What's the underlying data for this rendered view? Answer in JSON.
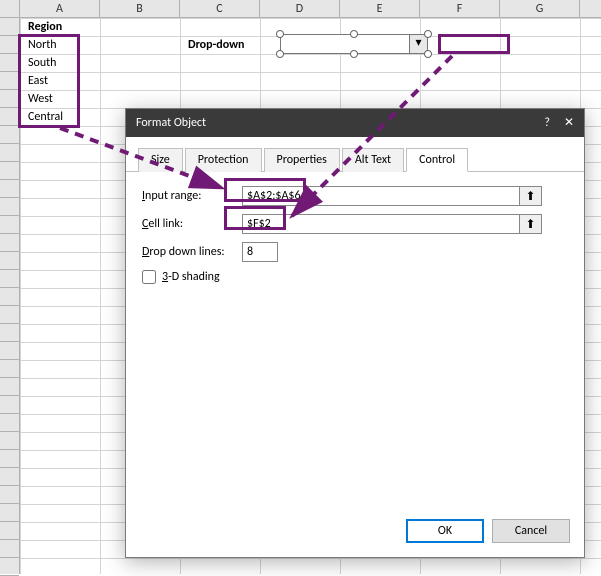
{
  "cols": [
    "A",
    "B",
    "C",
    "D",
    "E",
    "F",
    "G"
  ],
  "cells": {
    "header": "Region",
    "a2": "North",
    "a3": "South",
    "a4": "East",
    "a5": "West",
    "a6": "Central",
    "label": "Drop-down"
  },
  "dialog": {
    "title": "Format Object",
    "help": "?",
    "close": "✕",
    "tabs": {
      "size": "Size",
      "protection": "Protection",
      "properties": "Properties",
      "alt": "Alt Text",
      "control": "Control"
    },
    "form": {
      "inputrange_lbl": "Input range:",
      "inputrange_val": "$A$2:$A$6",
      "celllink_lbl": "Cell link:",
      "celllink_val": "$F$2",
      "ddlines_lbl": "Drop down lines:",
      "ddlines_val": "8",
      "shade_lbl": "3-D shading"
    },
    "ok": "OK",
    "cancel": "Cancel"
  },
  "glyph": {
    "chevdown": "▾",
    "refpick": "⬆"
  }
}
